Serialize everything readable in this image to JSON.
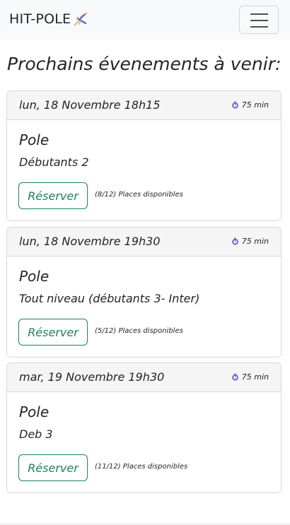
{
  "navbar": {
    "brand": "HIT-POLE",
    "logo_icon": "pole-dancer-icon",
    "toggler_icon": "hamburger-menu-icon"
  },
  "page": {
    "title": "Prochains évenements à venir:"
  },
  "events": [
    {
      "date": "lun, 18 Novembre 18h15",
      "duration": "75 min",
      "activity": "Pole",
      "level": "Débutants 2",
      "button": "Réserver",
      "places": "(8/12) Places disponibles"
    },
    {
      "date": "lun, 18 Novembre 19h30",
      "duration": "75 min",
      "activity": "Pole",
      "level": "Tout niveau (débutants 3- Inter)",
      "button": "Réserver",
      "places": "(5/12) Places disponibles"
    },
    {
      "date": "mar, 19 Novembre 19h30",
      "duration": "75 min",
      "activity": "Pole",
      "level": "Deb 3",
      "button": "Réserver",
      "places": "(11/12) Places disponibles"
    }
  ],
  "colors": {
    "accent": "#198754",
    "timer_icon": "#5b3fd6"
  }
}
